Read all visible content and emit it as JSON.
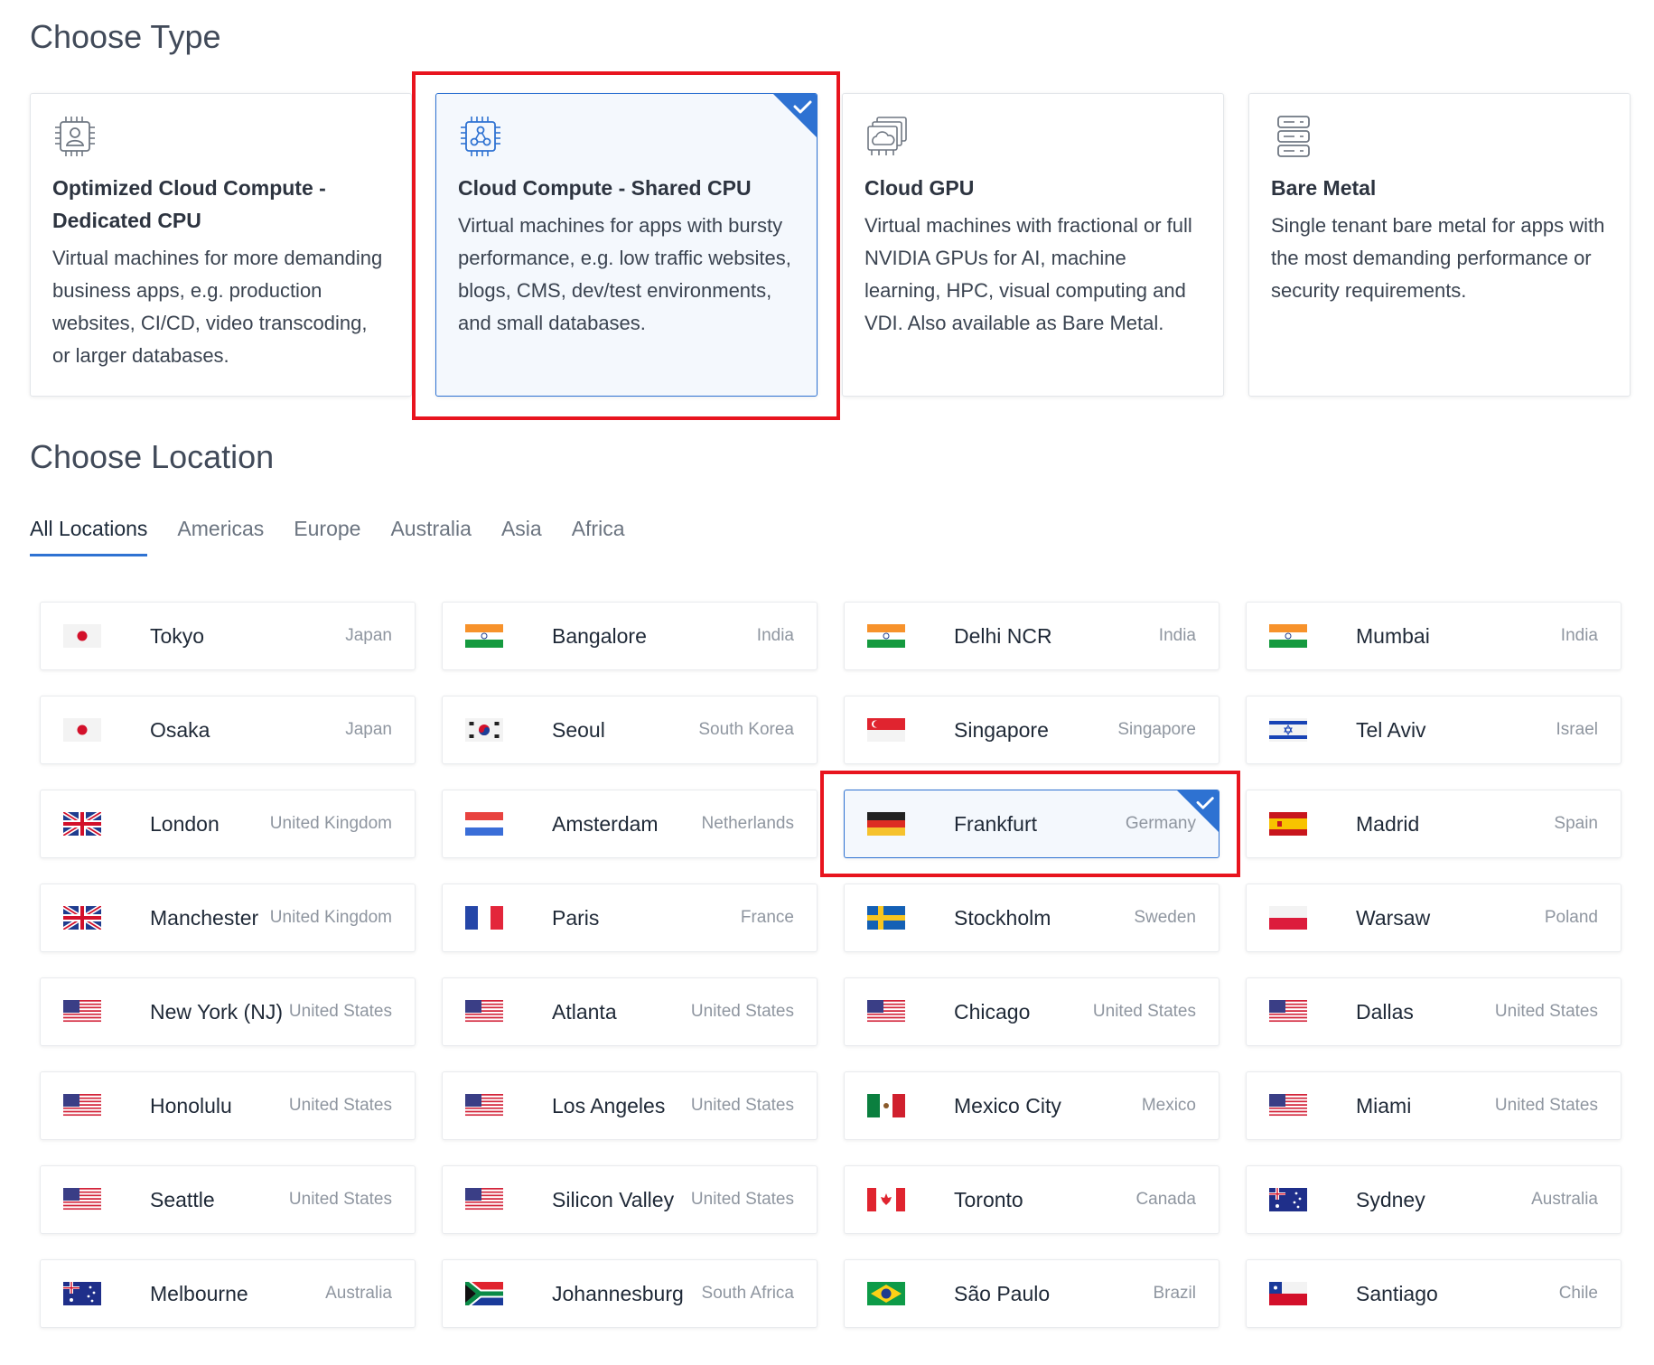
{
  "type_section": {
    "title": "Choose Type",
    "types": [
      {
        "name": "Optimized Cloud Compute - Dedicated CPU",
        "desc": "Virtual machines for more demanding business apps, e.g. production websites, CI/CD, video transcoding, or larger databases.",
        "icon": "chip-user-icon",
        "selected": false
      },
      {
        "name": "Cloud Compute - Shared CPU",
        "desc": "Virtual machines for apps with bursty performance, e.g. low traffic websites, blogs, CMS, dev/test environments, and small databases.",
        "icon": "chip-nodes-icon",
        "selected": true
      },
      {
        "name": "Cloud GPU",
        "desc": "Virtual machines with fractional or full NVIDIA GPUs for AI, machine learning, HPC, visual computing and VDI. Also available as Bare Metal.",
        "icon": "gpu-cloud-icon",
        "selected": false
      },
      {
        "name": "Bare Metal",
        "desc": "Single tenant bare metal for apps with the most demanding performance or security requirements.",
        "icon": "server-rack-icon",
        "selected": false
      }
    ]
  },
  "location_section": {
    "title": "Choose Location",
    "tabs": [
      {
        "label": "All Locations",
        "active": true
      },
      {
        "label": "Americas",
        "active": false
      },
      {
        "label": "Europe",
        "active": false
      },
      {
        "label": "Australia",
        "active": false
      },
      {
        "label": "Asia",
        "active": false
      },
      {
        "label": "Africa",
        "active": false
      }
    ],
    "locations": [
      {
        "city": "Tokyo",
        "country": "Japan",
        "flag": "jp"
      },
      {
        "city": "Bangalore",
        "country": "India",
        "flag": "in"
      },
      {
        "city": "Delhi NCR",
        "country": "India",
        "flag": "in"
      },
      {
        "city": "Mumbai",
        "country": "India",
        "flag": "in"
      },
      {
        "city": "Osaka",
        "country": "Japan",
        "flag": "jp"
      },
      {
        "city": "Seoul",
        "country": "South Korea",
        "flag": "kr"
      },
      {
        "city": "Singapore",
        "country": "Singapore",
        "flag": "sg"
      },
      {
        "city": "Tel Aviv",
        "country": "Israel",
        "flag": "il"
      },
      {
        "city": "London",
        "country": "United Kingdom",
        "flag": "gb"
      },
      {
        "city": "Amsterdam",
        "country": "Netherlands",
        "flag": "nl"
      },
      {
        "city": "Frankfurt",
        "country": "Germany",
        "flag": "de",
        "selected": true
      },
      {
        "city": "Madrid",
        "country": "Spain",
        "flag": "es"
      },
      {
        "city": "Manchester",
        "country": "United Kingdom",
        "flag": "gb"
      },
      {
        "city": "Paris",
        "country": "France",
        "flag": "fr"
      },
      {
        "city": "Stockholm",
        "country": "Sweden",
        "flag": "se"
      },
      {
        "city": "Warsaw",
        "country": "Poland",
        "flag": "pl"
      },
      {
        "city": "New York (NJ)",
        "country": "United States",
        "flag": "us"
      },
      {
        "city": "Atlanta",
        "country": "United States",
        "flag": "us"
      },
      {
        "city": "Chicago",
        "country": "United States",
        "flag": "us"
      },
      {
        "city": "Dallas",
        "country": "United States",
        "flag": "us"
      },
      {
        "city": "Honolulu",
        "country": "United States",
        "flag": "us"
      },
      {
        "city": "Los Angeles",
        "country": "United States",
        "flag": "us"
      },
      {
        "city": "Mexico City",
        "country": "Mexico",
        "flag": "mx"
      },
      {
        "city": "Miami",
        "country": "United States",
        "flag": "us"
      },
      {
        "city": "Seattle",
        "country": "United States",
        "flag": "us"
      },
      {
        "city": "Silicon Valley",
        "country": "United States",
        "flag": "us"
      },
      {
        "city": "Toronto",
        "country": "Canada",
        "flag": "ca"
      },
      {
        "city": "Sydney",
        "country": "Australia",
        "flag": "au"
      },
      {
        "city": "Melbourne",
        "country": "Australia",
        "flag": "au"
      },
      {
        "city": "Johannesburg",
        "country": "South Africa",
        "flag": "za"
      },
      {
        "city": "São Paulo",
        "country": "Brazil",
        "flag": "br"
      },
      {
        "city": "Santiago",
        "country": "Chile",
        "flag": "cl"
      }
    ]
  },
  "colors": {
    "accent": "#2e72d2",
    "highlight": "#e8141e"
  }
}
